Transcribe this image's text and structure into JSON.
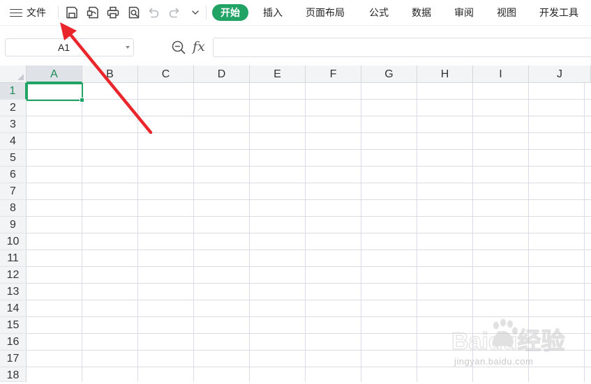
{
  "menubar": {
    "file_label": "文件",
    "tabs": [
      {
        "label": "开始",
        "active": true
      },
      {
        "label": "插入"
      },
      {
        "label": "页面布局"
      },
      {
        "label": "公式"
      },
      {
        "label": "数据"
      },
      {
        "label": "审阅"
      },
      {
        "label": "视图"
      },
      {
        "label": "开发工具"
      }
    ],
    "tools": [
      "save-icon",
      "export-pdf-icon",
      "print-icon",
      "print-preview-icon",
      "undo-icon",
      "redo-icon",
      "more-dropdown-icon"
    ]
  },
  "formula_bar": {
    "name_box": "A1",
    "fx_label": "fx",
    "formula": ""
  },
  "sheet": {
    "columns": [
      "A",
      "B",
      "C",
      "D",
      "E",
      "F",
      "G",
      "H",
      "I",
      "J"
    ],
    "rows": [
      "1",
      "2",
      "3",
      "4",
      "5",
      "6",
      "7",
      "8",
      "9",
      "10",
      "11",
      "12",
      "13",
      "14",
      "15",
      "16",
      "17",
      "18"
    ],
    "selected_column": "A",
    "selected_row": "1"
  },
  "colors": {
    "accent": "#21a366",
    "arrow": "#e8262b",
    "grid": "#d9dce7",
    "header_bg": "#f3f4f6"
  },
  "watermark": {
    "logo_text": "Baidu经验",
    "url": "jingyan.baidu.com"
  }
}
